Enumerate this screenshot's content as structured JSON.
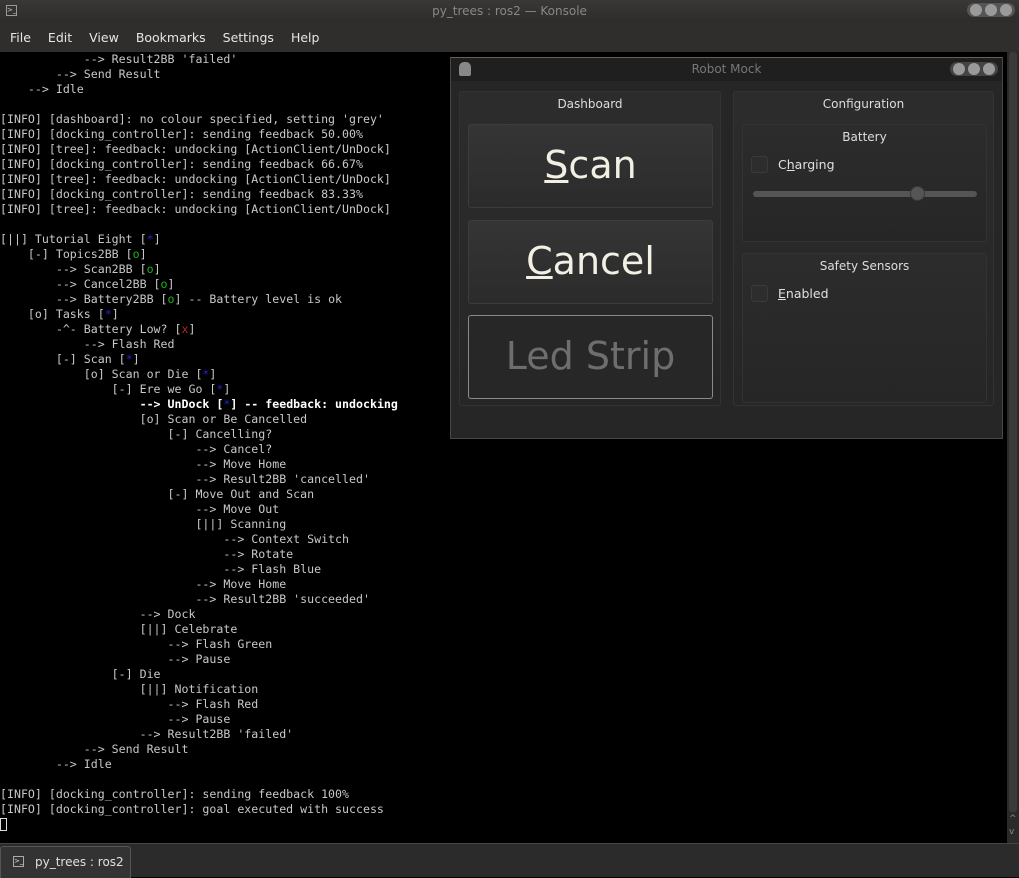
{
  "window": {
    "title": "py_trees : ros2 — Konsole",
    "icon": "terminal-icon"
  },
  "menu": [
    "File",
    "Edit",
    "View",
    "Bookmarks",
    "Settings",
    "Help"
  ],
  "colors": {
    "text": "#c8c8c8",
    "green": "#1db31d",
    "blue": "#2424c8",
    "red": "#c02020",
    "highlight": "#ffffff"
  },
  "terminal": {
    "lines": [
      [
        {
          "t": "            --> Result2BB 'failed'"
        }
      ],
      [
        {
          "t": "        --> Send Result"
        }
      ],
      [
        {
          "t": "    --> Idle"
        }
      ],
      [
        {
          "t": ""
        }
      ],
      [
        {
          "t": "[INFO] [dashboard]: no colour specified, setting 'grey'"
        }
      ],
      [
        {
          "t": "[INFO] [docking_controller]: sending feedback 50.00%"
        }
      ],
      [
        {
          "t": "[INFO] [tree]: feedback: undocking [ActionClient/UnDock]"
        }
      ],
      [
        {
          "t": "[INFO] [docking_controller]: sending feedback 66.67%"
        }
      ],
      [
        {
          "t": "[INFO] [tree]: feedback: undocking [ActionClient/UnDock]"
        }
      ],
      [
        {
          "t": "[INFO] [docking_controller]: sending feedback 83.33%"
        }
      ],
      [
        {
          "t": "[INFO] [tree]: feedback: undocking [ActionClient/UnDock]"
        }
      ],
      [
        {
          "t": ""
        }
      ],
      [
        {
          "t": "[||] Tutorial Eight ["
        },
        {
          "t": "*",
          "c": "blue"
        },
        {
          "t": "]"
        }
      ],
      [
        {
          "t": "    [-] Topics2BB ["
        },
        {
          "t": "o",
          "c": "green"
        },
        {
          "t": "]"
        }
      ],
      [
        {
          "t": "        --> Scan2BB ["
        },
        {
          "t": "o",
          "c": "green"
        },
        {
          "t": "]"
        }
      ],
      [
        {
          "t": "        --> Cancel2BB ["
        },
        {
          "t": "o",
          "c": "green"
        },
        {
          "t": "]"
        }
      ],
      [
        {
          "t": "        --> Battery2BB ["
        },
        {
          "t": "o",
          "c": "green"
        },
        {
          "t": "] -- Battery level is ok"
        }
      ],
      [
        {
          "t": "    [o] Tasks ["
        },
        {
          "t": "*",
          "c": "blue"
        },
        {
          "t": "]"
        }
      ],
      [
        {
          "t": "        -^- Battery Low? ["
        },
        {
          "t": "x",
          "c": "red"
        },
        {
          "t": "]"
        }
      ],
      [
        {
          "t": "            --> Flash Red"
        }
      ],
      [
        {
          "t": "        [-] Scan ["
        },
        {
          "t": "*",
          "c": "blue"
        },
        {
          "t": "]"
        }
      ],
      [
        {
          "t": "            [o] Scan or Die ["
        },
        {
          "t": "*",
          "c": "blue"
        },
        {
          "t": "]"
        }
      ],
      [
        {
          "t": "                [-] Ere we Go ["
        },
        {
          "t": "*",
          "c": "blue"
        },
        {
          "t": "]"
        }
      ],
      [
        {
          "t": "                    --> UnDock [",
          "c": "highlight"
        },
        {
          "t": "*",
          "c": "blue"
        },
        {
          "t": "] -- feedback: undocking",
          "c": "highlight"
        }
      ],
      [
        {
          "t": "                    [o] Scan or Be Cancelled"
        }
      ],
      [
        {
          "t": "                        [-] Cancelling?"
        }
      ],
      [
        {
          "t": "                            --> Cancel?"
        }
      ],
      [
        {
          "t": "                            --> Move Home"
        }
      ],
      [
        {
          "t": "                            --> Result2BB 'cancelled'"
        }
      ],
      [
        {
          "t": "                        [-] Move Out and Scan"
        }
      ],
      [
        {
          "t": "                            --> Move Out"
        }
      ],
      [
        {
          "t": "                            [||] Scanning"
        }
      ],
      [
        {
          "t": "                                --> Context Switch"
        }
      ],
      [
        {
          "t": "                                --> Rotate"
        }
      ],
      [
        {
          "t": "                                --> Flash Blue"
        }
      ],
      [
        {
          "t": "                            --> Move Home"
        }
      ],
      [
        {
          "t": "                            --> Result2BB 'succeeded'"
        }
      ],
      [
        {
          "t": "                    --> Dock"
        }
      ],
      [
        {
          "t": "                    [||] Celebrate"
        }
      ],
      [
        {
          "t": "                        --> Flash Green"
        }
      ],
      [
        {
          "t": "                        --> Pause"
        }
      ],
      [
        {
          "t": "                [-] Die"
        }
      ],
      [
        {
          "t": "                    [||] Notification"
        }
      ],
      [
        {
          "t": "                        --> Flash Red"
        }
      ],
      [
        {
          "t": "                        --> Pause"
        }
      ],
      [
        {
          "t": "                    --> Result2BB 'failed'"
        }
      ],
      [
        {
          "t": "            --> Send Result"
        }
      ],
      [
        {
          "t": "        --> Idle"
        }
      ],
      [
        {
          "t": ""
        }
      ],
      [
        {
          "t": "[INFO] [docking_controller]: sending feedback 100%"
        }
      ],
      [
        {
          "t": "[INFO] [docking_controller]: goal executed with success"
        }
      ]
    ]
  },
  "robot_mock": {
    "title": "Robot Mock",
    "dashboard": {
      "title": "Dashboard",
      "scan": {
        "mnemonic": "S",
        "rest": "can"
      },
      "cancel": {
        "mnemonic": "C",
        "rest": "ancel"
      },
      "led_strip": "Led Strip"
    },
    "configuration": {
      "title": "Configuration",
      "battery": {
        "title": "Battery",
        "charging": {
          "pre": "C",
          "mnemonic": "h",
          "rest": "arging",
          "checked": false
        },
        "level_fraction": 0.75
      },
      "safety": {
        "title": "Safety Sensors",
        "enabled": {
          "mnemonic": "E",
          "rest": "nabled",
          "checked": false
        }
      }
    }
  },
  "tab": {
    "label": "py_trees : ros2",
    "icon": "terminal-icon"
  }
}
